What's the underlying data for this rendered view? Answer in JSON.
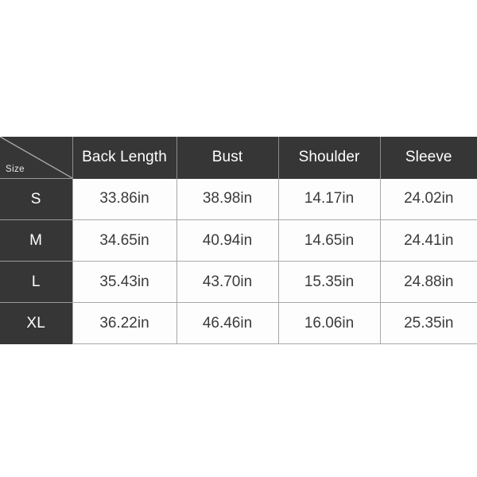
{
  "chart_data": {
    "type": "table",
    "title": "",
    "corner_label": "Size",
    "columns": [
      "Size",
      "Back Length",
      "Bust",
      "Shoulder",
      "Sleeve"
    ],
    "categories": [
      "S",
      "M",
      "L",
      "XL"
    ],
    "unit": "in",
    "series": [
      {
        "name": "Back Length",
        "values": [
          33.86,
          34.65,
          35.43,
          36.22
        ]
      },
      {
        "name": "Bust",
        "values": [
          38.98,
          40.94,
          43.7,
          46.46
        ]
      },
      {
        "name": "Shoulder",
        "values": [
          14.17,
          14.65,
          15.35,
          16.06
        ]
      },
      {
        "name": "Sleeve",
        "values": [
          24.02,
          24.41,
          24.88,
          25.35
        ]
      }
    ],
    "rows": [
      {
        "size": "S",
        "back_length": "33.86in",
        "bust": "38.98in",
        "shoulder": "14.17in",
        "sleeve": "24.02in"
      },
      {
        "size": "M",
        "back_length": "34.65in",
        "bust": "40.94in",
        "shoulder": "14.65in",
        "sleeve": "24.41in"
      },
      {
        "size": "L",
        "back_length": "35.43in",
        "bust": "43.70in",
        "shoulder": "15.35in",
        "sleeve": "24.88in"
      },
      {
        "size": "XL",
        "back_length": "36.22in",
        "bust": "46.46in",
        "shoulder": "16.06in",
        "sleeve": "25.35in"
      }
    ]
  },
  "table": {
    "corner_label": "Size",
    "headers": {
      "back_length": "Back Length",
      "bust": "Bust",
      "shoulder": "Shoulder",
      "sleeve": "Sleeve"
    },
    "rows": [
      {
        "size": "S",
        "back_length": "33.86in",
        "bust": "38.98in",
        "shoulder": "14.17in",
        "sleeve": "24.02in"
      },
      {
        "size": "M",
        "back_length": "34.65in",
        "bust": "40.94in",
        "shoulder": "14.65in",
        "sleeve": "24.41in"
      },
      {
        "size": "L",
        "back_length": "35.43in",
        "bust": "43.70in",
        "shoulder": "15.35in",
        "sleeve": "24.88in"
      },
      {
        "size": "XL",
        "back_length": "36.22in",
        "bust": "46.46in",
        "shoulder": "16.06in",
        "sleeve": "25.35in"
      }
    ]
  },
  "colors": {
    "header_bg": "#363636",
    "header_text": "#ffffff",
    "cell_bg": "#fdfdfd",
    "cell_text": "#3b3b3b",
    "border": "#a8a8a8",
    "page_bg": "#ffffff"
  }
}
